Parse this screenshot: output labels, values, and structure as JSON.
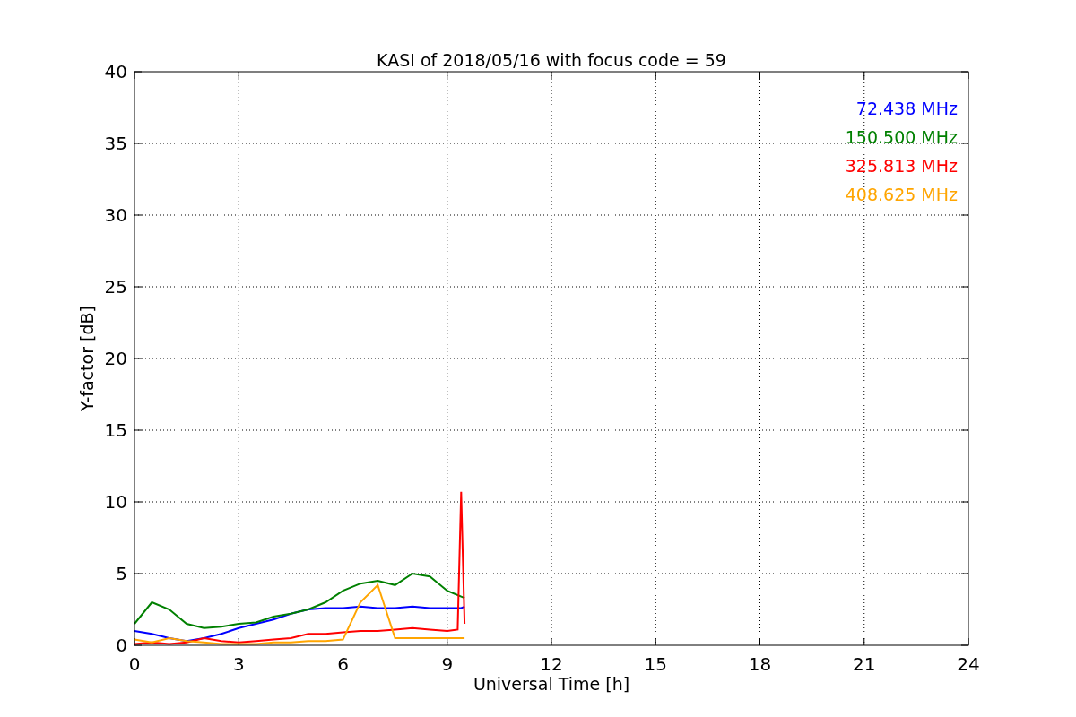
{
  "chart_data": {
    "type": "line",
    "title": "KASI of 2018/05/16 with focus code = 59",
    "xlabel": "Universal Time [h]",
    "ylabel": "Y-factor [dB]",
    "x": [
      0,
      0.5,
      1,
      1.5,
      2,
      2.5,
      3,
      3.5,
      4,
      4.5,
      5,
      5.5,
      6,
      6.5,
      7,
      7.5,
      8,
      8.5,
      9,
      9.3,
      9.4,
      9.5
    ],
    "series": [
      {
        "name": "72.438 MHz",
        "color": "#0000ff",
        "values": [
          1.0,
          0.8,
          0.5,
          0.3,
          0.5,
          0.8,
          1.2,
          1.5,
          1.8,
          2.2,
          2.5,
          2.6,
          2.6,
          2.7,
          2.6,
          2.6,
          2.7,
          2.6,
          2.6,
          2.6,
          2.6,
          2.7
        ]
      },
      {
        "name": "150.500 MHz",
        "color": "#008000",
        "values": [
          1.5,
          3.0,
          2.5,
          1.5,
          1.2,
          1.3,
          1.5,
          1.6,
          2.0,
          2.2,
          2.5,
          3.0,
          3.8,
          4.3,
          4.5,
          4.2,
          5.0,
          4.8,
          3.8,
          3.5,
          3.4,
          3.3
        ]
      },
      {
        "name": "325.813 MHz",
        "color": "#ff0000",
        "values": [
          0.1,
          0.2,
          0.1,
          0.2,
          0.5,
          0.3,
          0.2,
          0.3,
          0.4,
          0.5,
          0.8,
          0.8,
          0.9,
          1.0,
          1.0,
          1.1,
          1.2,
          1.1,
          1.0,
          1.1,
          10.7,
          1.5
        ]
      },
      {
        "name": "408.625 MHz",
        "color": "#ffa500",
        "values": [
          0.4,
          0.2,
          0.5,
          0.3,
          0.2,
          0.1,
          0.1,
          0.1,
          0.2,
          0.2,
          0.3,
          0.3,
          0.4,
          3.0,
          4.2,
          0.5,
          0.5,
          0.5,
          0.5,
          0.5,
          0.5,
          0.5
        ]
      }
    ],
    "grid": true,
    "xlim": [
      0,
      24
    ],
    "ylim": [
      0,
      40
    ],
    "xticks": [
      0,
      3,
      6,
      9,
      12,
      15,
      18,
      21,
      24
    ],
    "yticks": [
      0,
      5,
      10,
      15,
      20,
      25,
      30,
      35,
      40
    ]
  }
}
